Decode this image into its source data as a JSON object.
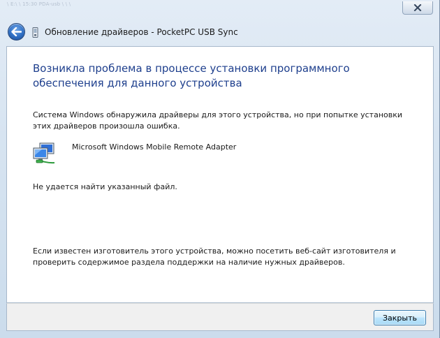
{
  "window": {
    "title": "Обновление драйверов - PocketPC USB Sync",
    "background_ghost_text": "\\ E:\\ \\ 15:30 PDA-usb \\ \\ \\",
    "close_glyph": "close-icon"
  },
  "nav": {
    "back_icon": "back-arrow-icon",
    "app_icon": "usb-device-icon"
  },
  "content": {
    "headline": "Возникла проблема в процессе установки программного обеспечения для данного устройства",
    "description": "Система Windows обнаружила драйверы для этого устройства, но при попытке установки этих драйверов произошла ошибка.",
    "device": {
      "icon": "network-adapter-icon",
      "name": "Microsoft Windows Mobile Remote Adapter"
    },
    "error": "Не удается найти указанный файл.",
    "advice": "Если известен изготовитель этого устройства, можно посетить веб-сайт изготовителя и проверить содержимое раздела поддержки на наличие нужных драйверов."
  },
  "footer": {
    "close_button_label": "Закрыть"
  },
  "colors": {
    "headline": "#1e3f8d",
    "frame": "#cbdcec",
    "button_border": "#3c7fb1"
  }
}
